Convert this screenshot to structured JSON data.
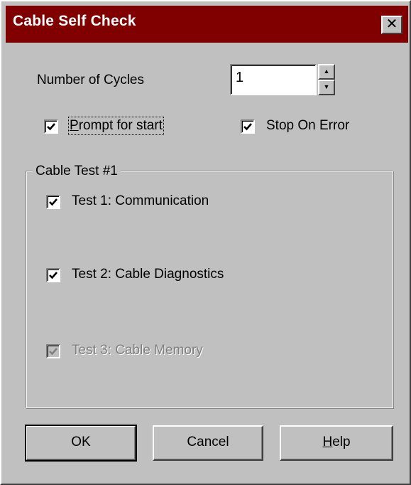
{
  "window": {
    "title": "Cable Self Check",
    "close_glyph": "✕"
  },
  "cycles": {
    "label": "Number of Cycles",
    "value": "1"
  },
  "options": {
    "prompt": {
      "label": "Prompt for start",
      "checked": true
    },
    "stop_on_error": {
      "label": "Stop On Error",
      "checked": true
    }
  },
  "group": {
    "title": "Cable Test #1",
    "tests": [
      {
        "label": "Test 1: Communication",
        "checked": true,
        "enabled": true
      },
      {
        "label": "Test 2: Cable Diagnostics",
        "checked": true,
        "enabled": true
      },
      {
        "label": "Test 3: Cable Memory",
        "checked": true,
        "enabled": false
      }
    ]
  },
  "buttons": {
    "ok": "OK",
    "cancel": "Cancel",
    "help_underlined": "H",
    "help_rest": "elp"
  },
  "colors": {
    "titlebar": "#800000",
    "face": "#c0c0c0",
    "disabled_text": "#808080"
  }
}
